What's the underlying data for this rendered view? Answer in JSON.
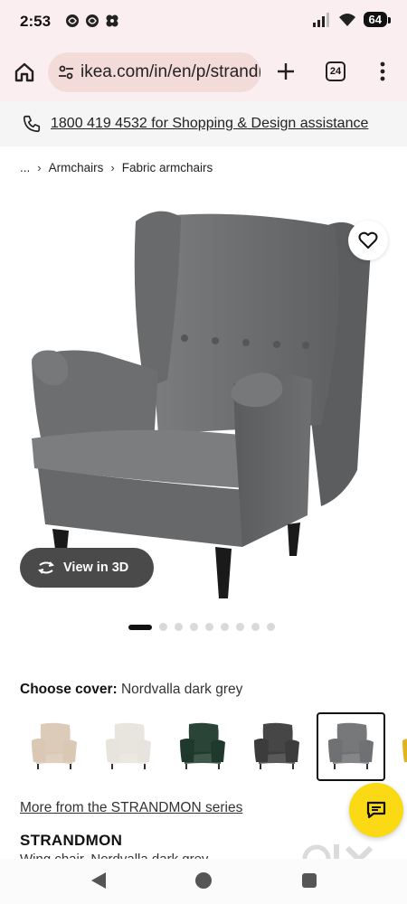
{
  "status": {
    "time": "2:53",
    "battery": "64",
    "app_icons": [
      "threads-icon",
      "threads-icon",
      "pinwheel-icon"
    ]
  },
  "browser": {
    "url": "ikea.com/in/en/p/strandmon",
    "tab_count": "24"
  },
  "assist": {
    "text": "1800 419 4532 for Shopping & Design assistance"
  },
  "breadcrumb": {
    "ellipsis": "...",
    "items": [
      "Armchairs",
      "Fabric armchairs"
    ]
  },
  "gallery": {
    "view3d_label": "View in 3D",
    "image_count": 9,
    "active_index": 0
  },
  "cover": {
    "label": "Choose cover:",
    "value": "Nordvalla dark grey",
    "options": [
      {
        "name": "beige",
        "color": "#d9c8b4"
      },
      {
        "name": "white",
        "color": "#e7e4dd"
      },
      {
        "name": "dark green",
        "color": "#1f3a2c"
      },
      {
        "name": "black grey",
        "color": "#3c3c3c"
      },
      {
        "name": "dark grey",
        "color": "#6f7173"
      },
      {
        "name": "yellow",
        "color": "#e0b321"
      }
    ],
    "selected_index": 4
  },
  "series": {
    "more_link": "More from the STRANDMON series",
    "product_name": "STRANDMON",
    "product_desc": "Wing chair, Nordvalla dark grey"
  },
  "colors": {
    "accent_yellow": "#fbd914",
    "browser_bg": "#fbeef0",
    "chair_grey": "#6f7173"
  },
  "watermark": "OLX"
}
